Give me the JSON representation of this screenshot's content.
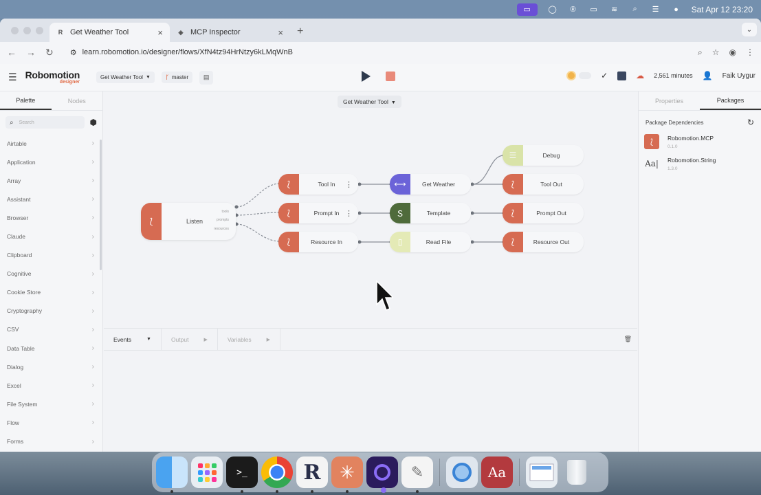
{
  "menubar": {
    "date_time": "Sat Apr 12  23:20"
  },
  "browser": {
    "tabs": [
      {
        "title": "Get Weather Tool",
        "favicon": "R"
      },
      {
        "title": "MCP Inspector",
        "favicon": "◈"
      }
    ],
    "url": "learn.robomotion.io/designer/flows/XfN4tz94HrNtzy6kLMqWnB"
  },
  "app": {
    "logo_main": "Robomotion",
    "logo_sub": "designer",
    "flow_selector": "Get Weather Tool",
    "branch": "master",
    "minutes": "2,561 minutes",
    "user_name": "Faik Uygur"
  },
  "sidebar": {
    "tabs": [
      "Palette",
      "Nodes"
    ],
    "search_placeholder": "Search",
    "items": [
      "Airtable",
      "Application",
      "Array",
      "Assistant",
      "Browser",
      "Claude",
      "Clipboard",
      "Cognitive",
      "Cookie Store",
      "Cryptography",
      "CSV",
      "Data Table",
      "Dialog",
      "Excel",
      "File System",
      "Flow",
      "Forms"
    ]
  },
  "canvas": {
    "flow_title": "Get Weather Tool",
    "listen_node": {
      "label": "Listen",
      "ports": [
        "tools",
        "prompts",
        "resources"
      ]
    },
    "nodes": {
      "tool_in": "Tool In",
      "prompt_in": "Prompt In",
      "resource_in": "Resource In",
      "get_weather": "Get Weather",
      "template": "Template",
      "read_file": "Read File",
      "debug": "Debug",
      "tool_out": "Tool Out",
      "prompt_out": "Prompt Out",
      "resource_out": "Resource Out"
    }
  },
  "bottom_panel": {
    "tabs": [
      "Events",
      "Output",
      "Variables"
    ]
  },
  "right_panel": {
    "tabs": [
      "Properties",
      "Packages"
    ],
    "section_title": "Package Dependencies",
    "packages": [
      {
        "name": "Robomotion.MCP",
        "version": "0.1.0"
      },
      {
        "name": "Robomotion.String",
        "version": "1.3.0"
      }
    ]
  },
  "colors": {
    "accent_red": "#d66b52",
    "purple": "#6b63d8",
    "green": "#4f6b3b",
    "lime": "#d9e3a8"
  },
  "dock": {
    "apps": [
      "finder-icon",
      "launchpad-icon",
      "terminal-icon",
      "chrome-icon",
      "robomotion-icon",
      "claude-icon",
      "arc-icon",
      "textedit-icon",
      "quicktime-icon",
      "dictionary-icon",
      "preview-icon",
      "trash-icon"
    ],
    "dictionary_label": "Aa"
  }
}
